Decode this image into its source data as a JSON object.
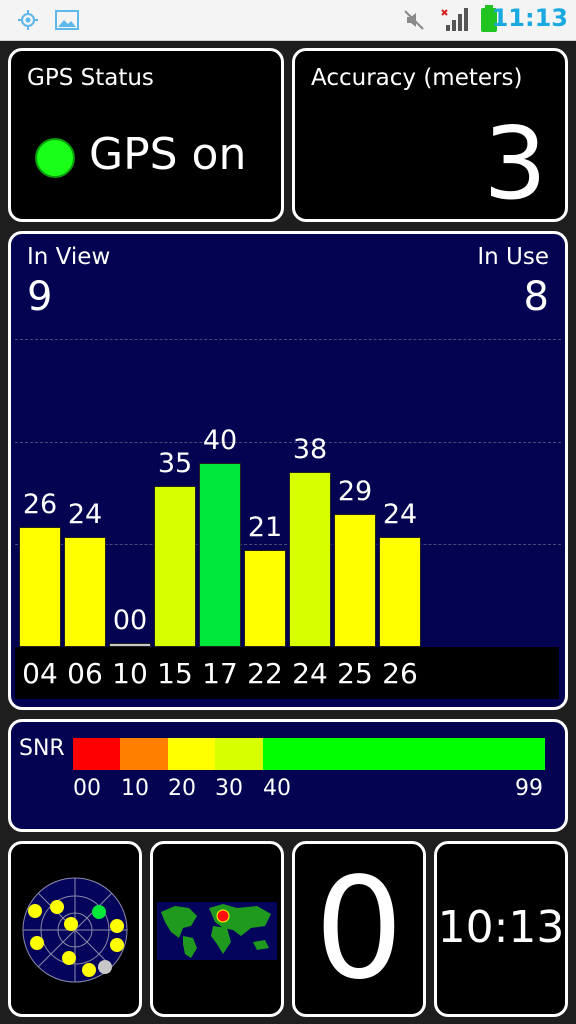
{
  "status_bar": {
    "time": "11:13",
    "left_icons": [
      "gps-target-icon",
      "image-icon"
    ],
    "right_icons": [
      "mute-icon",
      "signal-no-data-icon",
      "battery-icon"
    ]
  },
  "gps_status": {
    "label": "GPS Status",
    "value": "GPS on",
    "indicator_color": "#1aff1a"
  },
  "accuracy": {
    "label": "Accuracy (meters)",
    "value": "3"
  },
  "satellites": {
    "in_view_label": "In View",
    "in_view": "9",
    "in_use_label": "In Use",
    "in_use": "8"
  },
  "chart_data": {
    "type": "bar",
    "categories": [
      "04",
      "06",
      "10",
      "15",
      "17",
      "22",
      "24",
      "25",
      "26"
    ],
    "values": [
      26,
      24,
      0,
      35,
      40,
      21,
      38,
      29,
      24
    ],
    "value_labels": [
      "26",
      "24",
      "00",
      "35",
      "40",
      "21",
      "38",
      "29",
      "24"
    ],
    "colors": [
      "#ffff00",
      "#ffff00",
      "#c8c8c8",
      "#d8ff00",
      "#00e83a",
      "#ffff00",
      "#d8ff00",
      "#ffff00",
      "#ffff00"
    ],
    "ylim": [
      0,
      50
    ],
    "grid": true
  },
  "snr_legend": {
    "title": "SNR",
    "ticks": [
      "00",
      "10",
      "20",
      "30",
      "40",
      "99"
    ],
    "colors": [
      "#ff0000",
      "#ff8000",
      "#ffff00",
      "#d8ff00",
      "#00ff00"
    ]
  },
  "bottom_tiles": {
    "radar_icon": "sky-view-icon",
    "map_icon": "world-map-icon",
    "counter": "0",
    "clock": "10:13"
  }
}
